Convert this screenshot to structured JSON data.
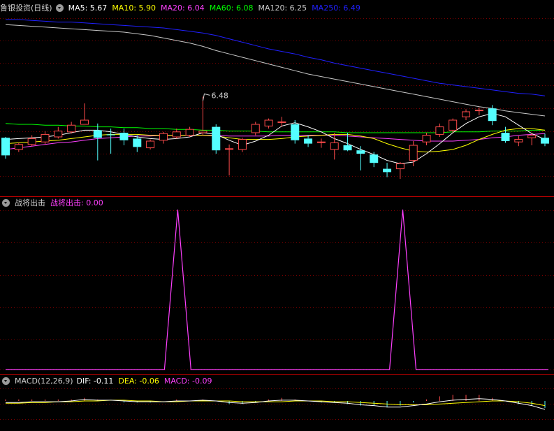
{
  "colors": {
    "up": "#ff4b4b",
    "down": "#54ffff",
    "ma5": "#ffffff",
    "ma10": "#ffff00",
    "ma20": "#ff40ff",
    "ma60": "#00ff00",
    "ma120": "#c8c8c8",
    "ma250": "#2020ff",
    "grid": "#7a0000",
    "separator": "#c00000",
    "label_gray": "#d0d0d0",
    "signal": "#ff40ff"
  },
  "panel1": {
    "title": "鲁银投资(日线)",
    "ma5": "MA5: 5.67",
    "ma10": "MA10: 5.90",
    "ma20": "MA20: 6.04",
    "ma60": "MA60: 6.08",
    "ma120": "MA120: 6.25",
    "ma250": "MA250: 6.49",
    "peak_label": "6.48"
  },
  "panel2": {
    "title": "战将出击",
    "value_label": "战将出击: 0.00"
  },
  "panel3": {
    "title": "MACD(12,26,9)",
    "dif": "DIF: -0.11",
    "dea": "DEA: -0.06",
    "macd": "MACD: -0.09"
  },
  "icons": [
    "collapse-circle-icon",
    "collapse-circle-icon",
    "collapse-circle-icon"
  ],
  "chart_data": [
    {
      "type": "candlestick",
      "title": "鲁银投资(日线)",
      "ohlc": [
        [
          5.99,
          6.0,
          5.74,
          5.78
        ],
        [
          5.85,
          5.93,
          5.82,
          5.91
        ],
        [
          5.91,
          6.02,
          5.89,
          5.98
        ],
        [
          5.94,
          6.07,
          5.91,
          6.03
        ],
        [
          6.0,
          6.12,
          5.98,
          6.07
        ],
        [
          6.06,
          6.18,
          6.04,
          6.14
        ],
        [
          6.15,
          6.4,
          6.15,
          6.2
        ],
        [
          6.08,
          6.16,
          5.72,
          5.99
        ],
        [
          6.03,
          6.1,
          5.8,
          6.02
        ],
        [
          6.05,
          6.1,
          5.9,
          5.96
        ],
        [
          5.98,
          6.02,
          5.82,
          5.88
        ],
        [
          5.87,
          5.97,
          5.85,
          5.95
        ],
        [
          5.96,
          6.06,
          5.92,
          6.04
        ],
        [
          6.0,
          6.1,
          5.98,
          6.06
        ],
        [
          6.02,
          6.12,
          6.0,
          6.09
        ],
        [
          6.05,
          6.48,
          6.02,
          6.07
        ],
        [
          6.12,
          6.15,
          5.8,
          5.84
        ],
        [
          5.86,
          5.91,
          5.54,
          5.86
        ],
        [
          5.85,
          5.99,
          5.82,
          5.97
        ],
        [
          6.05,
          6.18,
          6.02,
          6.15
        ],
        [
          6.13,
          6.22,
          6.1,
          6.2
        ],
        [
          6.18,
          6.24,
          6.12,
          6.18
        ],
        [
          6.15,
          6.2,
          5.92,
          5.96
        ],
        [
          5.98,
          6.02,
          5.88,
          5.92
        ],
        [
          5.94,
          5.98,
          5.87,
          5.94
        ],
        [
          5.85,
          6.05,
          5.73,
          5.93
        ],
        [
          5.9,
          6.05,
          5.83,
          5.84
        ],
        [
          5.84,
          5.89,
          5.6,
          5.8
        ],
        [
          5.79,
          5.82,
          5.64,
          5.69
        ],
        [
          5.62,
          5.69,
          5.52,
          5.58
        ],
        [
          5.62,
          5.7,
          5.5,
          5.68
        ],
        [
          5.72,
          5.95,
          5.65,
          5.9
        ],
        [
          5.94,
          6.05,
          5.9,
          6.02
        ],
        [
          6.03,
          6.16,
          6.0,
          6.12
        ],
        [
          6.08,
          6.22,
          6.05,
          6.2
        ],
        [
          6.24,
          6.33,
          6.2,
          6.3
        ],
        [
          6.32,
          6.35,
          6.26,
          6.32
        ],
        [
          6.34,
          6.38,
          6.14,
          6.19
        ],
        [
          6.05,
          6.12,
          5.93,
          5.95
        ],
        [
          5.94,
          6.01,
          5.89,
          5.97
        ],
        [
          5.99,
          6.05,
          5.9,
          6.02
        ],
        [
          5.99,
          6.04,
          5.89,
          5.92
        ]
      ],
      "series": [
        {
          "name": "MA5",
          "values": [
            5.97,
            5.98,
            5.99,
            6.0,
            6.02,
            6.05,
            6.08,
            6.08,
            6.06,
            6.03,
            6.0,
            5.98,
            5.97,
            5.98,
            6.0,
            6.05,
            6.03,
            5.96,
            5.9,
            5.95,
            6.02,
            6.13,
            6.17,
            6.12,
            6.06,
            5.98,
            5.92,
            5.85,
            5.79,
            5.72,
            5.68,
            5.7,
            5.8,
            5.92,
            6.05,
            6.16,
            6.24,
            6.28,
            6.24,
            6.14,
            6.04,
            5.97
          ]
        },
        {
          "name": "MA10",
          "values": [
            5.92,
            5.93,
            5.94,
            5.95,
            5.96,
            5.98,
            6.0,
            6.02,
            6.03,
            6.03,
            6.03,
            6.02,
            6.02,
            6.02,
            6.02,
            6.02,
            6.01,
            5.99,
            5.97,
            5.97,
            5.97,
            5.98,
            6.0,
            6.01,
            6.02,
            6.03,
            6.03,
            6.01,
            5.98,
            5.92,
            5.87,
            5.83,
            5.82,
            5.83,
            5.85,
            5.9,
            5.97,
            6.03,
            6.08,
            6.1,
            6.1,
            6.08
          ]
        },
        {
          "name": "MA20",
          "values": [
            5.85,
            5.87,
            5.89,
            5.91,
            5.93,
            5.94,
            5.96,
            5.98,
            5.99,
            6.0,
            6.01,
            6.01,
            6.02,
            6.02,
            6.02,
            6.02,
            6.02,
            6.01,
            6.01,
            6.01,
            6.01,
            6.02,
            6.02,
            6.02,
            6.02,
            6.02,
            6.01,
            6.0,
            5.99,
            5.98,
            5.97,
            5.96,
            5.95,
            5.95,
            5.95,
            5.96,
            5.97,
            5.99,
            6.0,
            6.02,
            6.03,
            6.04
          ]
        },
        {
          "name": "MA60",
          "values": [
            6.16,
            6.15,
            6.15,
            6.14,
            6.14,
            6.13,
            6.13,
            6.12,
            6.12,
            6.11,
            6.11,
            6.1,
            6.1,
            6.09,
            6.09,
            6.08,
            6.08,
            6.07,
            6.07,
            6.07,
            6.06,
            6.06,
            6.06,
            6.06,
            6.06,
            6.06,
            6.05,
            6.05,
            6.05,
            6.05,
            6.05,
            6.05,
            6.05,
            6.05,
            6.06,
            6.06,
            6.06,
            6.07,
            6.07,
            6.07,
            6.08,
            6.08
          ]
        },
        {
          "name": "MA120",
          "values": [
            7.34,
            7.33,
            7.32,
            7.31,
            7.3,
            7.29,
            7.28,
            7.27,
            7.26,
            7.25,
            7.23,
            7.21,
            7.18,
            7.15,
            7.12,
            7.08,
            7.03,
            6.99,
            6.95,
            6.91,
            6.87,
            6.83,
            6.79,
            6.75,
            6.72,
            6.69,
            6.66,
            6.63,
            6.6,
            6.57,
            6.54,
            6.51,
            6.48,
            6.45,
            6.42,
            6.39,
            6.36,
            6.34,
            6.31,
            6.29,
            6.27,
            6.25
          ]
        },
        {
          "name": "MA250",
          "values": [
            7.4,
            7.4,
            7.39,
            7.38,
            7.37,
            7.37,
            7.36,
            7.35,
            7.34,
            7.33,
            7.32,
            7.31,
            7.3,
            7.28,
            7.26,
            7.24,
            7.21,
            7.17,
            7.13,
            7.09,
            7.05,
            7.02,
            6.99,
            6.95,
            6.92,
            6.88,
            6.85,
            6.82,
            6.79,
            6.76,
            6.73,
            6.7,
            6.67,
            6.64,
            6.62,
            6.6,
            6.58,
            6.56,
            6.54,
            6.52,
            6.51,
            6.49
          ]
        }
      ],
      "annotations": [
        {
          "index": 15,
          "value": 6.48,
          "text": "6.48"
        }
      ]
    },
    {
      "type": "line",
      "title": "战将出击",
      "series": [
        {
          "name": "战将出击",
          "values": [
            0,
            0,
            0,
            0,
            0,
            0,
            0,
            0,
            0,
            0,
            0,
            0,
            0,
            1,
            0,
            0,
            0,
            0,
            0,
            0,
            0,
            0,
            0,
            0,
            0,
            0,
            0,
            0,
            0,
            0,
            1,
            0,
            0,
            0,
            0,
            0,
            0,
            0,
            0,
            0,
            0,
            0
          ]
        }
      ]
    },
    {
      "type": "line",
      "title": "MACD(12,26,9)",
      "series": [
        {
          "name": "DIF",
          "values": [
            -0.02,
            -0.02,
            -0.01,
            -0.01,
            -0.01,
            0.0,
            0.02,
            0.01,
            0.01,
            0.0,
            -0.01,
            -0.01,
            -0.01,
            0.0,
            0.0,
            0.01,
            0.0,
            -0.02,
            -0.03,
            -0.02,
            0.0,
            0.01,
            0.01,
            0.0,
            -0.01,
            -0.02,
            -0.03,
            -0.05,
            -0.06,
            -0.08,
            -0.08,
            -0.06,
            -0.04,
            -0.01,
            0.01,
            0.02,
            0.03,
            0.02,
            0.0,
            -0.03,
            -0.06,
            -0.11
          ]
        },
        {
          "name": "DEA",
          "values": [
            -0.03,
            -0.03,
            -0.02,
            -0.02,
            -0.01,
            -0.01,
            0.0,
            0.0,
            0.01,
            0.01,
            0.0,
            0.0,
            -0.01,
            -0.01,
            0.0,
            0.0,
            0.0,
            0.0,
            -0.01,
            -0.01,
            -0.01,
            -0.01,
            0.0,
            0.0,
            0.0,
            -0.01,
            -0.01,
            -0.02,
            -0.03,
            -0.04,
            -0.05,
            -0.05,
            -0.05,
            -0.04,
            -0.03,
            -0.02,
            -0.01,
            0.0,
            0.0,
            -0.01,
            -0.03,
            -0.06
          ]
        },
        {
          "name": "MACD",
          "values": [
            0.02,
            0.02,
            0.02,
            0.02,
            0.02,
            0.02,
            0.04,
            0.02,
            0.0,
            -0.02,
            -0.02,
            -0.02,
            0.0,
            0.02,
            0.0,
            0.02,
            0.0,
            -0.04,
            -0.04,
            -0.02,
            0.02,
            0.04,
            0.02,
            0.0,
            -0.02,
            -0.02,
            -0.04,
            -0.06,
            -0.06,
            -0.08,
            -0.06,
            -0.02,
            0.02,
            0.06,
            0.08,
            0.08,
            0.08,
            0.04,
            0.0,
            -0.04,
            -0.06,
            -0.09
          ]
        }
      ]
    }
  ]
}
